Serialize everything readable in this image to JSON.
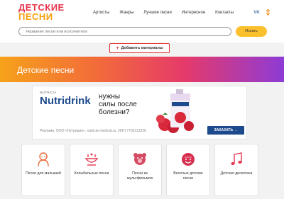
{
  "logo": {
    "line1": "ДЕТСКИЕ",
    "line2": "ПЕСНИ"
  },
  "nav": [
    {
      "label": "Артисты"
    },
    {
      "label": "Жанры"
    },
    {
      "label": "Лучшие песни"
    },
    {
      "label": "Интересное"
    },
    {
      "label": "Контакты"
    }
  ],
  "social": {
    "vk": "VK",
    "ok": "ОК"
  },
  "search": {
    "placeholder": "Название песни или исполнителя",
    "button": "Искать"
  },
  "add_material": {
    "label": "Добавить материалы"
  },
  "banner": {
    "title": "Детские песни"
  },
  "ad": {
    "brand_small": "NUTRICIA",
    "brand": "Nutridrink",
    "slogan": [
      "нужны",
      "силы после",
      "болезни?"
    ],
    "legal": "Реклама. ООО «Нутриция». nutricia-medical.ru. ИНН 7705113220",
    "cta": "ЗАКАЗАТЬ →",
    "product_label": "Nutridrink"
  },
  "categories": [
    {
      "label": "Песни для малышей",
      "icon": "baby-icon",
      "color": "#e86a3a"
    },
    {
      "label": "Колыбельные песни",
      "icon": "cradle-icon",
      "color": "#e8344e"
    },
    {
      "label": "Песни из мультфильмов",
      "icon": "teddy-bear-icon",
      "color": "#d44b62"
    },
    {
      "label": "Веселые детские песни",
      "icon": "smiley-ball-icon",
      "color": "#d6304f"
    },
    {
      "label": "Детская дискотека",
      "icon": "music-notes-icon",
      "color": "#e8344e"
    }
  ]
}
